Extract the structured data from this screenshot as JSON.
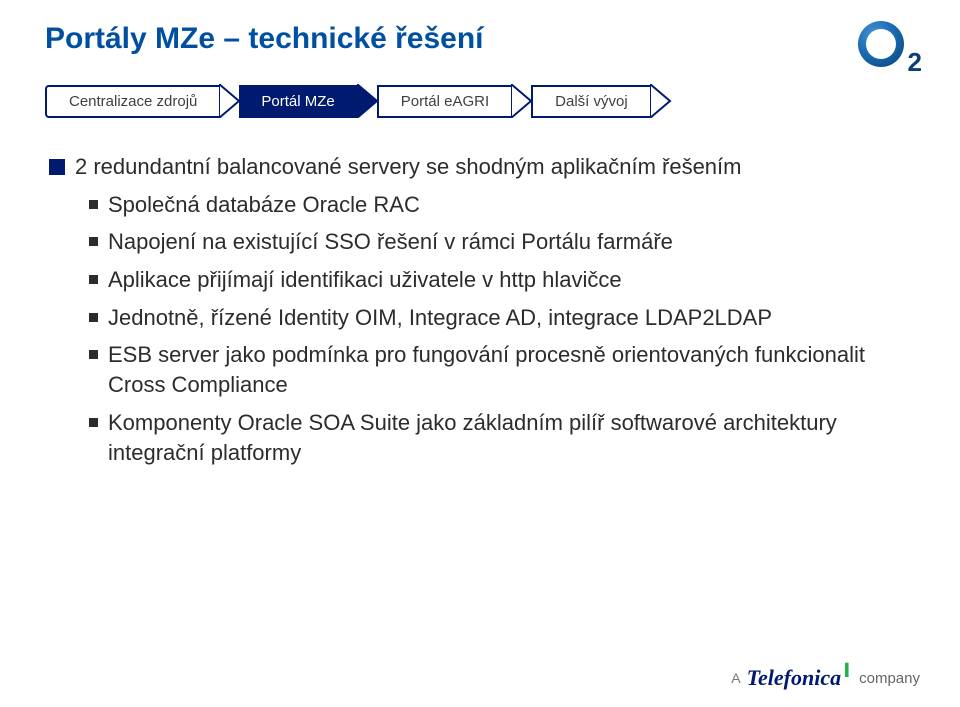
{
  "title": "Portály MZe – technické řešení",
  "breadcrumb": [
    {
      "label": "Centralizace zdrojů",
      "active": false
    },
    {
      "label": "Portál MZe",
      "active": true
    },
    {
      "label": "Portál eAGRI",
      "active": false
    },
    {
      "label": "Další vývoj",
      "active": false
    }
  ],
  "bullets": [
    {
      "level": 1,
      "text": "2 redundantní balancované servery se shodným aplikačním řešením"
    },
    {
      "level": 2,
      "text": "Společná databáze Oracle RAC"
    },
    {
      "level": 2,
      "text": "Napojení na existující SSO řešení v rámci Portálu farmáře"
    },
    {
      "level": 2,
      "text": "Aplikace přijímají identifikaci uživatele v http hlavičce"
    },
    {
      "level": 2,
      "text": "Jednotně, řízené Identity OIM, Integrace AD, integrace LDAP2LDAP"
    },
    {
      "level": 2,
      "text": "ESB server jako podmínka pro fungování procesně orientovaných funkcionalit Cross Compliance"
    },
    {
      "level": 2,
      "text": "Komponenty Oracle SOA Suite jako základním pilíř softwarové architektury integrační platformy"
    }
  ],
  "logo": {
    "name": "O2",
    "sub": "2"
  },
  "footer": {
    "prefix": "A",
    "brand": "Telefonica",
    "suffix": "company"
  },
  "colors": {
    "accent": "#001a6f",
    "title": "#0050a1"
  }
}
